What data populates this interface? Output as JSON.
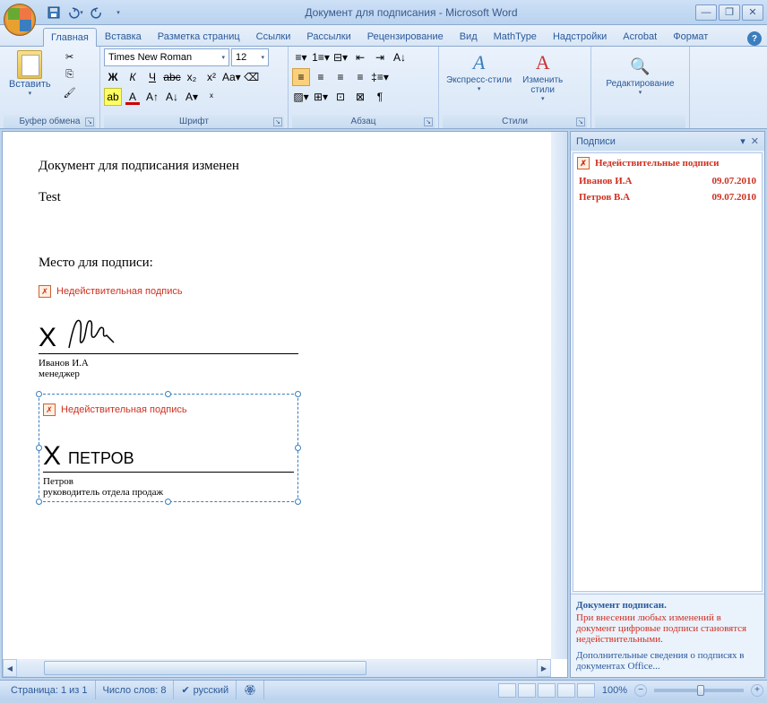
{
  "title": "Документ для подписания - Microsoft Word",
  "qat": {
    "save_icon": "save-icon",
    "undo_icon": "undo-icon",
    "redo_icon": "redo-icon"
  },
  "tabs": [
    "Главная",
    "Вставка",
    "Разметка страниц",
    "Ссылки",
    "Рассылки",
    "Рецензирование",
    "Вид",
    "MathType",
    "Надстройки",
    "Acrobat",
    "Формат"
  ],
  "active_tab_index": 0,
  "ribbon": {
    "clipboard": {
      "label": "Буфер обмена",
      "paste": "Вставить"
    },
    "font": {
      "label": "Шрифт",
      "name": "Times New Roman",
      "size": "12"
    },
    "paragraph": {
      "label": "Абзац"
    },
    "styles": {
      "label": "Стили",
      "quick": "Экспресс-стили",
      "change": "Изменить\nстили"
    },
    "editing": {
      "label": "Редактирование"
    }
  },
  "document": {
    "line1": "Документ для подписания изменен",
    "line2": "Test",
    "sig_label": "Место для подписи:",
    "invalid_text": "Недействительная подпись",
    "sig1": {
      "name": "Иванов И.А",
      "title": "менеджер"
    },
    "sig2": {
      "typed": "ПЕТРОВ",
      "name": "Петров",
      "title": "руководитель отдела продаж"
    }
  },
  "panel": {
    "title": "Подписи",
    "invalid_header": "Недействительные подписи",
    "rows": [
      {
        "name": "Иванов И.А",
        "date": "09.07.2010"
      },
      {
        "name": "Петров В.А",
        "date": "09.07.2010"
      }
    ],
    "footer_title": "Документ подписан.",
    "footer_warn": "При внесении любых изменений в документ цифровые подписи становятся недействительными.",
    "footer_link": "Дополнительные сведения о подписях в документах Office..."
  },
  "status": {
    "page": "Страница: 1 из 1",
    "words": "Число слов: 8",
    "lang": "русский",
    "zoom": "100%"
  }
}
